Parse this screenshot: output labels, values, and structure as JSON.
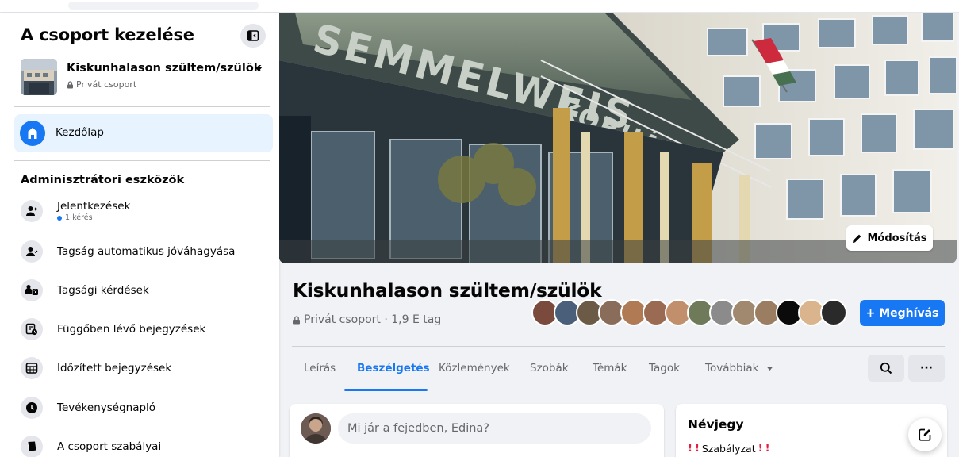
{
  "sidebar": {
    "title": "A csoport kezelése",
    "group": {
      "name": "Kiskunhalason szültem/szülök",
      "privacy": "Privát csoport"
    },
    "home_label": "Kezdőlap",
    "admin_heading": "Adminisztrátori eszközök",
    "admin_items": [
      {
        "label": "Jelentkezések",
        "sub": "1 kérés",
        "icon": "person-add-icon"
      },
      {
        "label": "Tagság automatikus jóváhagyása",
        "icon": "person-check-icon"
      },
      {
        "label": "Tagsági kérdések",
        "icon": "person-question-icon"
      },
      {
        "label": "Függőben lévő bejegyzések",
        "icon": "pending-posts-icon"
      },
      {
        "label": "Időzített bejegyzések",
        "icon": "calendar-icon"
      },
      {
        "label": "Tevékenységnapló",
        "icon": "clock-icon"
      },
      {
        "label": "A csoport szabályai",
        "icon": "book-icon"
      }
    ]
  },
  "cover": {
    "sign_text": "SEMMELWEIS KÓRHÁZ",
    "edit_label": "Módosítás"
  },
  "group_header": {
    "title": "Kiskunhalason szültem/szülök",
    "meta": "Privát csoport · 1,9 E tag",
    "invite_label": "+ Meghívás"
  },
  "tabs": [
    {
      "label": "Leírás",
      "active": false
    },
    {
      "label": "Beszélgetés",
      "active": true
    },
    {
      "label": "Közlemények",
      "active": false
    },
    {
      "label": "Szobák",
      "active": false
    },
    {
      "label": "Témák",
      "active": false
    },
    {
      "label": "Tagok",
      "active": false
    },
    {
      "label": "Továbbiak",
      "active": false
    }
  ],
  "more_options_label": "···",
  "composer": {
    "placeholder": "Mi jár a fejedben, Edina?"
  },
  "about": {
    "title": "Névjegy",
    "rule_text": "Szabályzat",
    "bang": "!"
  },
  "colors": {
    "accent": "#1877f2",
    "alert": "#e41e3f",
    "active_bg": "#e7f3ff"
  }
}
